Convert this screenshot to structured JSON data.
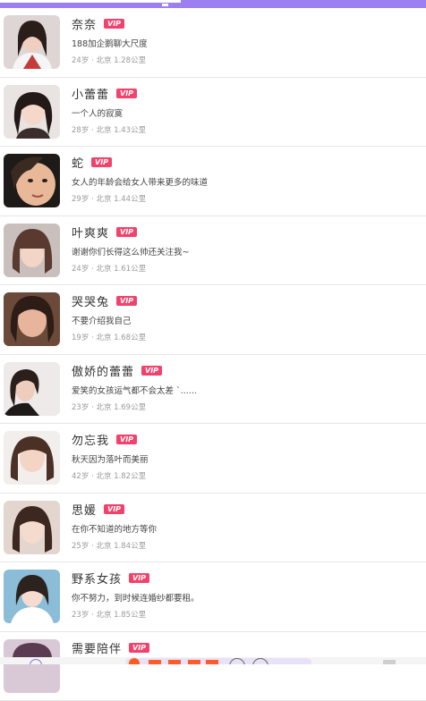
{
  "users": [
    {
      "name": "奈奈",
      "vip_label": "VIP",
      "signature": "188加企鹅聊大尺度",
      "age_label": "24岁",
      "city": "北京",
      "distance": "1.28公里"
    },
    {
      "name": "小蕾蕾",
      "vip_label": "VIP",
      "signature": "一个人的寂寞",
      "age_label": "28岁",
      "city": "北京",
      "distance": "1.43公里"
    },
    {
      "name": "蛇",
      "vip_label": "VIP",
      "signature": "女人的年龄会给女人带来更多的味道",
      "age_label": "29岁",
      "city": "北京",
      "distance": "1.44公里"
    },
    {
      "name": "叶爽爽",
      "vip_label": "VIP",
      "signature": "谢谢你们长得这么帅还关注我~",
      "age_label": "24岁",
      "city": "北京",
      "distance": "1.61公里"
    },
    {
      "name": "哭哭兔",
      "vip_label": "VIP",
      "signature": "不要介绍我自己",
      "age_label": "19岁",
      "city": "北京",
      "distance": "1.68公里"
    },
    {
      "name": "傲娇的蕾蕾",
      "vip_label": "VIP",
      "signature": "爱笑的女孩运气都不会太差 `......",
      "age_label": "23岁",
      "city": "北京",
      "distance": "1.69公里"
    },
    {
      "name": "勿忘我",
      "vip_label": "VIP",
      "signature": "秋天因为落叶而美丽",
      "age_label": "42岁",
      "city": "北京",
      "distance": "1.82公里"
    },
    {
      "name": "思媛",
      "vip_label": "VIP",
      "signature": "在你不知道的地方等你",
      "age_label": "25岁",
      "city": "北京",
      "distance": "1.84公里"
    },
    {
      "name": "野系女孩",
      "vip_label": "VIP",
      "signature": "你不努力，到时候连婚纱都要租。",
      "age_label": "23岁",
      "city": "北京",
      "distance": "1.85公里"
    },
    {
      "name": "需要陪伴",
      "vip_label": "VIP",
      "signature": "",
      "age_label": "",
      "city": "",
      "distance": ""
    }
  ],
  "meta_separator": "·",
  "colors": {
    "accent": "#9c7ff0",
    "vip_badge": "#f2426b",
    "name": "#333333",
    "signature": "#444444",
    "meta": "#9a9a9a",
    "divider": "#e6e6e6"
  },
  "icons": {
    "bottom_left": "home-icon",
    "bottom_center_badge": "notification-badge",
    "bottom_circles": [
      "chat-icon",
      "discover-icon"
    ],
    "bottom_right": "profile-icon"
  }
}
